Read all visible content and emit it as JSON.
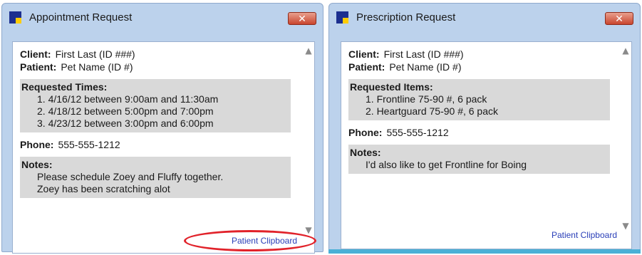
{
  "appointment_window": {
    "title": "Appointment Request",
    "close_label": "✕",
    "client_label": "Client:",
    "client_value": "First Last (ID ###)",
    "patient_label": "Patient:",
    "patient_value": "Pet Name (ID #)",
    "requested_times_heading": "Requested Times:",
    "requested_times": [
      "1. 4/16/12 between 9:00am and 11:30am",
      "2. 4/18/12 between 5:00pm and 7:00pm",
      "3. 4/23/12 between 3:00pm and 6:00pm"
    ],
    "phone_label": "Phone:",
    "phone_value": "555-555-1212",
    "notes_heading": "Notes:",
    "notes_lines": [
      "Please schedule Zoey and Fluffy together.",
      "Zoey has been scratching alot"
    ],
    "footer_link": "Patient Clipboard"
  },
  "prescription_window": {
    "title": "Prescription Request",
    "close_label": "✕",
    "client_label": "Client:",
    "client_value": "First Last (ID ###)",
    "patient_label": "Patient:",
    "patient_value": "Pet Name (ID #)",
    "requested_items_heading": "Requested Items:",
    "requested_items": [
      "1. Frontline 75-90 #, 6 pack",
      "2. Heartguard 75-90 #, 6 pack"
    ],
    "phone_label": "Phone:",
    "phone_value": "555-555-1212",
    "notes_heading": "Notes:",
    "notes_lines": [
      "I'd also like to get Frontline for Boing"
    ],
    "footer_link": "Patient Clipboard"
  },
  "icons": {
    "scroll_up": "▲",
    "scroll_down": "▼"
  },
  "colors": {
    "window_frame": "#bcd2ec",
    "section_background": "#d9d9d9",
    "link": "#2a3fb8",
    "highlight_circle": "#e1222a",
    "close_button": "#c9452e"
  }
}
